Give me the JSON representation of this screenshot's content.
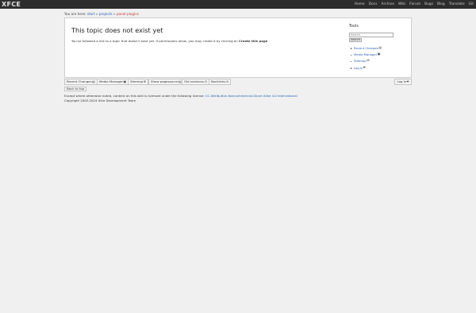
{
  "header": {
    "logo": "XFCE",
    "nav": [
      "Home",
      "Docs",
      "Archive",
      "Wiki",
      "Forum",
      "Bugs",
      "Blog",
      "Translate",
      "Git"
    ]
  },
  "breadcrumb": {
    "prefix": "You are here:",
    "items": [
      "start",
      "projects",
      "panel-plugins"
    ],
    "separator": "»"
  },
  "main": {
    "title": "This topic does not exist yet",
    "message_before": "You've followed a link to a topic that doesn't exist yet. If permissions allow, you may create it by clicking on",
    "create_link": "Create this page",
    "message_after": "."
  },
  "sidebar": {
    "heading": "Tools",
    "search_placeholder": "Search",
    "search_button": "Search",
    "tools": [
      {
        "label": "Recent Changes",
        "icon": "recent-changes-icon",
        "glyph": "▤"
      },
      {
        "label": "Media Manager",
        "icon": "media-manager-icon",
        "glyph": "▣"
      },
      {
        "label": "Sitemap",
        "icon": "sitemap-icon",
        "glyph": "⊞"
      },
      {
        "label": "Log In",
        "icon": "login-icon",
        "glyph": "⎆"
      }
    ]
  },
  "pagetools": {
    "items": [
      {
        "label": "Recent Changes",
        "glyph": "▤"
      },
      {
        "label": "Media Manager",
        "glyph": "▣"
      },
      {
        "label": "Sitemap",
        "glyph": "⊞"
      },
      {
        "label": "Show pagesource",
        "glyph": "▤"
      },
      {
        "label": "Old revisions",
        "glyph": "◷"
      },
      {
        "label": "Backlinks",
        "glyph": "⊘"
      }
    ],
    "login": {
      "label": "Log In",
      "glyph": "⎆"
    },
    "back_to_top": "Back to top"
  },
  "footer": {
    "license_text": "Except where otherwise noted, content on this wiki is licensed under the following license:",
    "license_link": "CC Attribution-Noncommercial-Share Alike 4.0 International",
    "copyright": "Copyright 2003-2024 Xfce Development Team"
  }
}
